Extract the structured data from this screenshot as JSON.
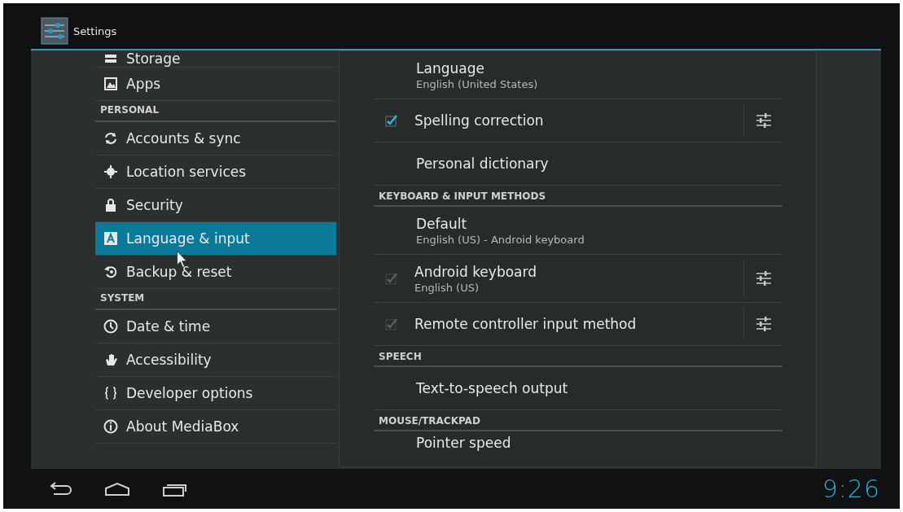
{
  "title_bar": {
    "title": "Settings"
  },
  "sidebar": {
    "items": [
      {
        "kind": "item",
        "label": "Storage",
        "selected": false
      },
      {
        "kind": "item",
        "label": "Apps",
        "selected": false
      },
      {
        "kind": "header",
        "label": "PERSONAL"
      },
      {
        "kind": "item",
        "label": "Accounts & sync",
        "selected": false
      },
      {
        "kind": "item",
        "label": "Location services",
        "selected": false
      },
      {
        "kind": "item",
        "label": "Security",
        "selected": false
      },
      {
        "kind": "item",
        "label": "Language & input",
        "selected": true
      },
      {
        "kind": "item",
        "label": "Backup & reset",
        "selected": false
      },
      {
        "kind": "header",
        "label": "SYSTEM"
      },
      {
        "kind": "item",
        "label": "Date & time",
        "selected": false
      },
      {
        "kind": "item",
        "label": "Accessibility",
        "selected": false
      },
      {
        "kind": "item",
        "label": "Developer options",
        "selected": false
      },
      {
        "kind": "item",
        "label": "About MediaBox",
        "selected": false
      }
    ]
  },
  "panel": {
    "items": [
      {
        "kind": "plain",
        "title": "Language",
        "summary": "English (United States)"
      },
      {
        "kind": "checkbox",
        "title": "Spelling correction",
        "checked": true,
        "disabled": false,
        "settings": true
      },
      {
        "kind": "plain",
        "title": "Personal dictionary"
      },
      {
        "kind": "header",
        "title": "KEYBOARD & INPUT METHODS"
      },
      {
        "kind": "plain",
        "title": "Default",
        "summary": "English (US) - Android keyboard"
      },
      {
        "kind": "checkbox",
        "title": "Android keyboard",
        "summary": "English (US)",
        "checked": true,
        "disabled": true,
        "settings": true
      },
      {
        "kind": "checkbox",
        "title": "Remote controller input method",
        "checked": true,
        "disabled": true,
        "settings": true
      },
      {
        "kind": "header",
        "title": "SPEECH"
      },
      {
        "kind": "plain",
        "title": "Text-to-speech output"
      },
      {
        "kind": "header",
        "title": "MOUSE/TRACKPAD"
      },
      {
        "kind": "plain",
        "title": "Pointer speed"
      }
    ]
  },
  "nav_bar": {
    "clock": "9:26"
  }
}
